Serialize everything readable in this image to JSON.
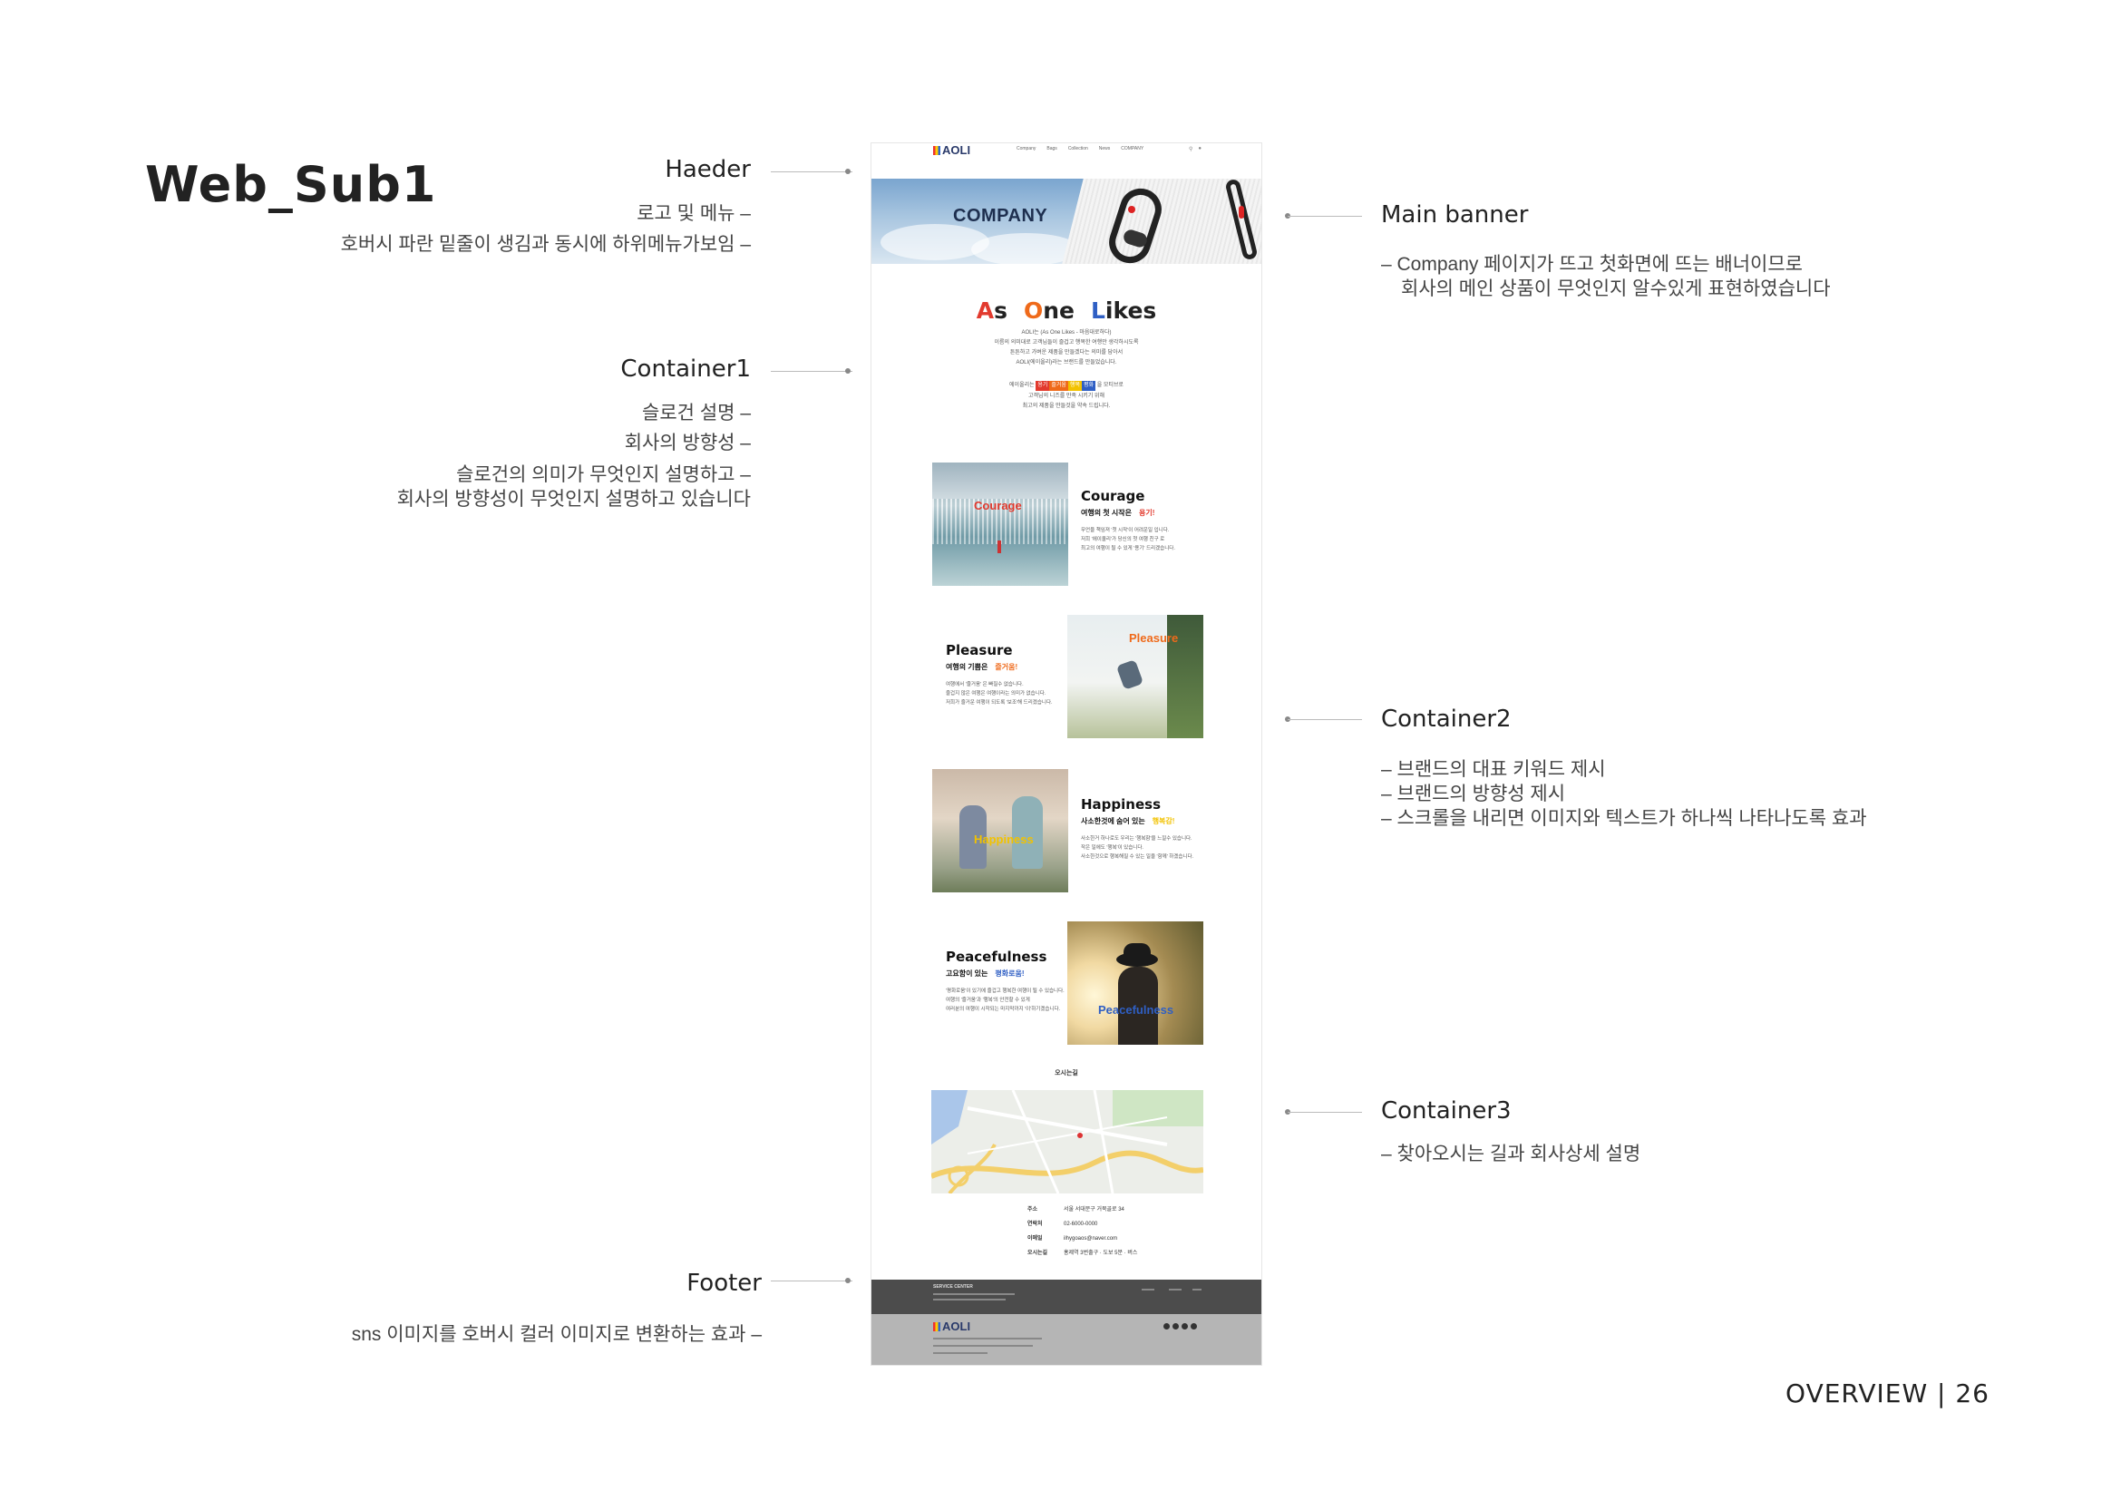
{
  "page_title": "Web_Sub1",
  "annotations": {
    "header": {
      "title": "Haeder",
      "lines": [
        "로고 및 메뉴 –",
        "호버시 파란 밑줄이 생김과 동시에 하위메뉴가보임 –"
      ]
    },
    "container1": {
      "title": "Container1",
      "lines": [
        "슬로건 설명 –",
        "회사의 방향성 –",
        "슬로건의 의미가 무엇인지 설명하고 –",
        "회사의 방향성이 무엇인지 설명하고 있습니다"
      ]
    },
    "footer": {
      "title": "Footer",
      "lines": [
        "sns 이미지를 호버시 컬러 이미지로 변환하는 효과 –"
      ]
    },
    "main_banner": {
      "title": "Main banner",
      "lines": [
        "– Company 페이지가 뜨고 첫화면에 뜨는 배너이므로",
        "회사의 메인 상품이 무엇인지 알수있게  표현하였습니다"
      ]
    },
    "container2": {
      "title": "Container2",
      "lines": [
        "– 브랜드의 대표 키워드 제시",
        "– 브랜드의 방향성 제시",
        "– 스크롤을 내리면 이미지와 텍스트가 하나씩 나타나도록 효과"
      ]
    },
    "container3": {
      "title": "Container3",
      "lines": [
        "– 찾아오시는 길과 회사상세 설명"
      ]
    }
  },
  "mockup": {
    "logo": "AOLI",
    "nav": [
      "Company",
      "Bags",
      "Collection",
      "News",
      "COMPANY"
    ],
    "banner_title": "COMPANY",
    "slogan": {
      "a": "A",
      "a_rest": "s",
      "o": "O",
      "o_rest": "ne",
      "l": "L",
      "l_rest": "ikes"
    },
    "intro_lines": [
      "AOLI는 (As One Likes - 마음대로하다)",
      "이름의 의미대로 고객님들이 즐겁고 행복한 여행만 생각하시도록",
      "튼튼하고 가벼운 제품을 만들겠다는 의미를 담아서",
      "AOLI(에이올리)라는 브랜드를 만들었습니다."
    ],
    "keyword_line_pre": "에이올리는",
    "keyword_line_post": "을 모티브로",
    "keywords": [
      {
        "text": "용기",
        "color": "#e23a2e"
      },
      {
        "text": "즐거움",
        "color": "#ef6a1a"
      },
      {
        "text": "행복",
        "color": "#f2c200"
      },
      {
        "text": "평화",
        "color": "#2f5fc4"
      }
    ],
    "keyword_tail_lines": [
      "고객님의 니즈를 만족 시키기 위해",
      "최고의 제품을 만들것을 약속 드립니다."
    ],
    "cards": [
      {
        "name": "Courage",
        "img_label": "Courage",
        "sub": "여행의  첫  시작은",
        "hl": "용기!",
        "hl_color": "#e23a2e",
        "body": [
          "무언을 책임져 '첫 시작'이 어려운일 입니다.",
          "저희 '에이올리'가 당신의 첫 여행 친구 로",
          "최고의 여행이 될 수 있게 '용기' 드리겠습니다."
        ]
      },
      {
        "name": "Pleasure",
        "img_label": "Pleasure",
        "sub": "여행의  기쁨은",
        "hl": "즐거움!",
        "hl_color": "#ef6a1a",
        "body": [
          "여행에서 '즐거움' 은 빠질수 없습니다.",
          "즐겁지 않은 여행은 여행이라는 의미가 없습니다.",
          "저희가 즐거운 여행이 되도록 '보조'해 드리겠습니다."
        ]
      },
      {
        "name": "Happiness",
        "img_label": "Happiness",
        "sub": "사소한것에  숨어  있는",
        "hl": "행복감!",
        "hl_color": "#f2c200",
        "body": [
          "사소한거 하나로도 우리는 '행복함'을 느낄수 있습니다.",
          "작은 일에도 '행복'이 있습니다.",
          "사소한것으로 행복해질 수 있는 일을 '함께' 하겠습니다."
        ]
      },
      {
        "name": "Peacefulness",
        "img_label": "Peacefulness",
        "sub": "고요함이  있는",
        "hl": "평화로움!",
        "hl_color": "#2f5fc4",
        "body": [
          "'평화로움'이 있기에 즐겁고 행복한 여행이 될 수 있습니다.",
          "여행의 '즐거움'과 '행복'의 안전할 수 있게",
          "여러분의 여행이 시작되는 마지막까지 '이'하기겠습니다."
        ]
      }
    ],
    "map_title": "오시는길",
    "info": [
      {
        "k": "주소",
        "v": "서울 서대문구 거북골로 34"
      },
      {
        "k": "연락처",
        "v": "02-6000-0000"
      },
      {
        "k": "이메일",
        "v": "ilhygoaos@naver.com"
      },
      {
        "k": "오시는길",
        "v": "홍제역 3번출구 ·  도보 5분  ·  버스"
      }
    ],
    "footer_service": "SERVICE CENTER",
    "footer_logo": "AOLI"
  },
  "overview": "OVERVIEW | 26",
  "colors": {
    "red": "#e23a2e",
    "orange": "#ef6a1a",
    "yellow": "#f2c200",
    "blue": "#2f5fc4",
    "footer_dark": "#4c4c4c",
    "footer_light": "#b5b5b5"
  }
}
